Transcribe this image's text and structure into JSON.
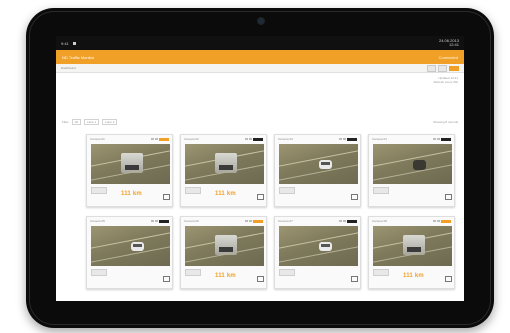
{
  "device": {
    "type": "tablet"
  },
  "statusbar": {
    "left_text": "9:41",
    "right_line1": "24.06.2013",
    "right_line2": "12:41"
  },
  "appbar": {
    "title": "ND Traffic Monitor",
    "right_text": "Connected"
  },
  "crumbbar": {
    "left_text": "Dashboard"
  },
  "meta": {
    "line1": "Updated 12:41",
    "line2": "Refresh every 30s"
  },
  "filterbar": {
    "left_text": "Filter",
    "chips": [
      "All",
      "Lane 1",
      "Lane 2"
    ],
    "right_text": "Showing 8 records"
  },
  "cards": [
    {
      "label": "Camera 01",
      "tag": "orange",
      "vehicle": "truck",
      "speed": "111 km",
      "speed_visible": true
    },
    {
      "label": "Camera 02",
      "tag": "dark",
      "vehicle": "truck",
      "speed": "111 km",
      "speed_visible": true
    },
    {
      "label": "Camera 03",
      "tag": "dark",
      "vehicle": "car",
      "speed": "",
      "speed_visible": false
    },
    {
      "label": "Camera 04",
      "tag": "dark",
      "vehicle": "darkcar",
      "speed": "",
      "speed_visible": false
    },
    {
      "label": "Camera 05",
      "tag": "dark",
      "vehicle": "car",
      "speed": "",
      "speed_visible": false
    },
    {
      "label": "Camera 06",
      "tag": "orange",
      "vehicle": "truck",
      "speed": "111 km",
      "speed_visible": true
    },
    {
      "label": "Camera 07",
      "tag": "dark",
      "vehicle": "car",
      "speed": "",
      "speed_visible": false
    },
    {
      "label": "Camera 08",
      "tag": "orange",
      "vehicle": "truck",
      "speed": "111 km",
      "speed_visible": true
    }
  ],
  "colors": {
    "accent": "#f0a026",
    "bezel": "#0b0b0b"
  }
}
